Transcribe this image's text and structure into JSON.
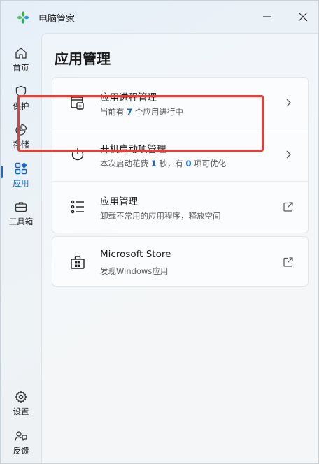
{
  "app": {
    "title": "电脑管家"
  },
  "sidebar": {
    "items": [
      {
        "label": "首页",
        "icon": "home-icon"
      },
      {
        "label": "保护",
        "icon": "shield-icon"
      },
      {
        "label": "存储",
        "icon": "pie-chart-icon"
      },
      {
        "label": "应用",
        "icon": "apps-icon",
        "active": true
      },
      {
        "label": "工具箱",
        "icon": "toolbox-icon"
      }
    ],
    "bottom": [
      {
        "label": "设置",
        "icon": "gear-icon"
      },
      {
        "label": "反馈",
        "icon": "feedback-icon"
      }
    ]
  },
  "page": {
    "title": "应用管理"
  },
  "rows": [
    {
      "title": "应用进程管理",
      "sub_pre": "当前有 ",
      "sub_num": "7",
      "sub_post": " 个应用进行中",
      "icon": "process-window-icon",
      "action": "chevron-right-icon"
    },
    {
      "title": "开机启动项管理",
      "sub_pre": "本次启动花费 ",
      "sub_num": "1",
      "sub_mid": " 秒，有 ",
      "sub_num2": "0",
      "sub_post": " 项可优化",
      "icon": "power-icon",
      "action": "chevron-right-icon"
    },
    {
      "title": "应用管理",
      "sub": "卸载不常用的应用程序，释放空间",
      "icon": "list-icon",
      "action": "external-link-icon"
    },
    {
      "title": "Microsoft Store",
      "sub": "发现Windows应用",
      "icon": "store-bag-icon",
      "action": "external-link-icon"
    }
  ],
  "colors": {
    "accent": "#1863c4",
    "highlight": "#e0403a"
  }
}
